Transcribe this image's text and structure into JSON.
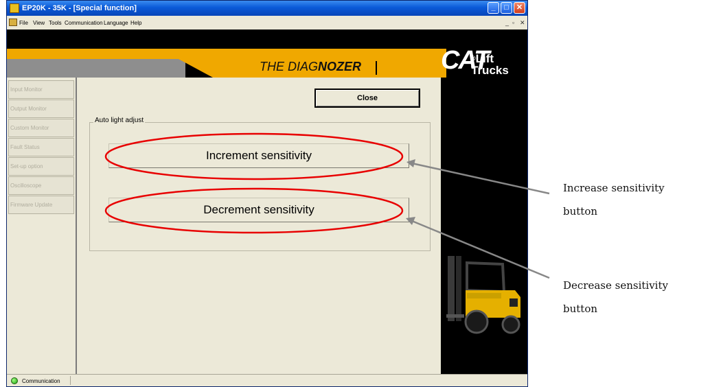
{
  "window": {
    "title": "EP20K - 35K - [Special function]",
    "controls": {
      "minimize": "_",
      "maximize": "□",
      "close": "✕"
    },
    "mdi_controls": {
      "minimize": "_",
      "restore": "▫",
      "close": "✕"
    }
  },
  "menubar": {
    "items": [
      "File",
      "View",
      "Tools",
      "Communication",
      "Language",
      "Help"
    ]
  },
  "header": {
    "brand_prefix": "THE DIAG",
    "brand_bold": "NOZER",
    "logo": "CAT",
    "logo_sub_line1": "Lift",
    "logo_sub_line2": "Trucks",
    "registered_mark": "®"
  },
  "nav": {
    "items": [
      "Input Monitor",
      "Output Monitor",
      "Custom Monitor",
      "Fault Status",
      "Set-up option",
      "Oscilloscope",
      "Firmware Update"
    ]
  },
  "content": {
    "close_label": "Close",
    "group_label": "Auto light adjust",
    "increment_label": "Increment sensitivity",
    "decrement_label": "Decrement sensitivity"
  },
  "statusbar": {
    "label": "Communication"
  },
  "annotations": {
    "increase_line1": "Increase sensitivity",
    "increase_line2": "button",
    "decrease_line1": "Decrease sensitivity",
    "decrease_line2": "button"
  },
  "colors": {
    "accent": "#f0a800",
    "highlight": "#e80000",
    "arrow": "#888888",
    "window_face": "#ece9d8"
  }
}
